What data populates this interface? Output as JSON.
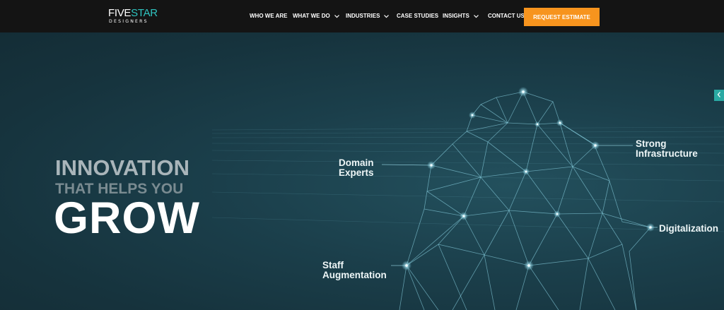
{
  "brand": {
    "logo_top_a": "FIVE",
    "logo_top_b": "STAR",
    "logo_bottom": "DESIGNERS",
    "accent_color": "#2fc4c0"
  },
  "nav": {
    "who_we_are": "WHO WE ARE",
    "what_we_do": "WHAT WE DO",
    "industries": "INDUSTRIES",
    "case_studies": "CASE STUDIES",
    "insights": "INSIGHTS",
    "contact_us": "CONTACT US",
    "cta": "REQUEST ESTIMATE",
    "cta_color": "#f7941e"
  },
  "hero": {
    "line1": "INNOVATION",
    "line2": "THAT HELPS YOU",
    "line3": "GROW",
    "callouts": {
      "domain_1": "Domain",
      "domain_2": "Experts",
      "strong_1": "Strong",
      "strong_2": "Infrastructure",
      "digitalization": "Digitalization",
      "staff_1": "Staff",
      "staff_2": "Augmentation"
    }
  },
  "icons": {
    "dropdown": "chevron-down-icon",
    "side_tab": "chevron-left-icon"
  }
}
